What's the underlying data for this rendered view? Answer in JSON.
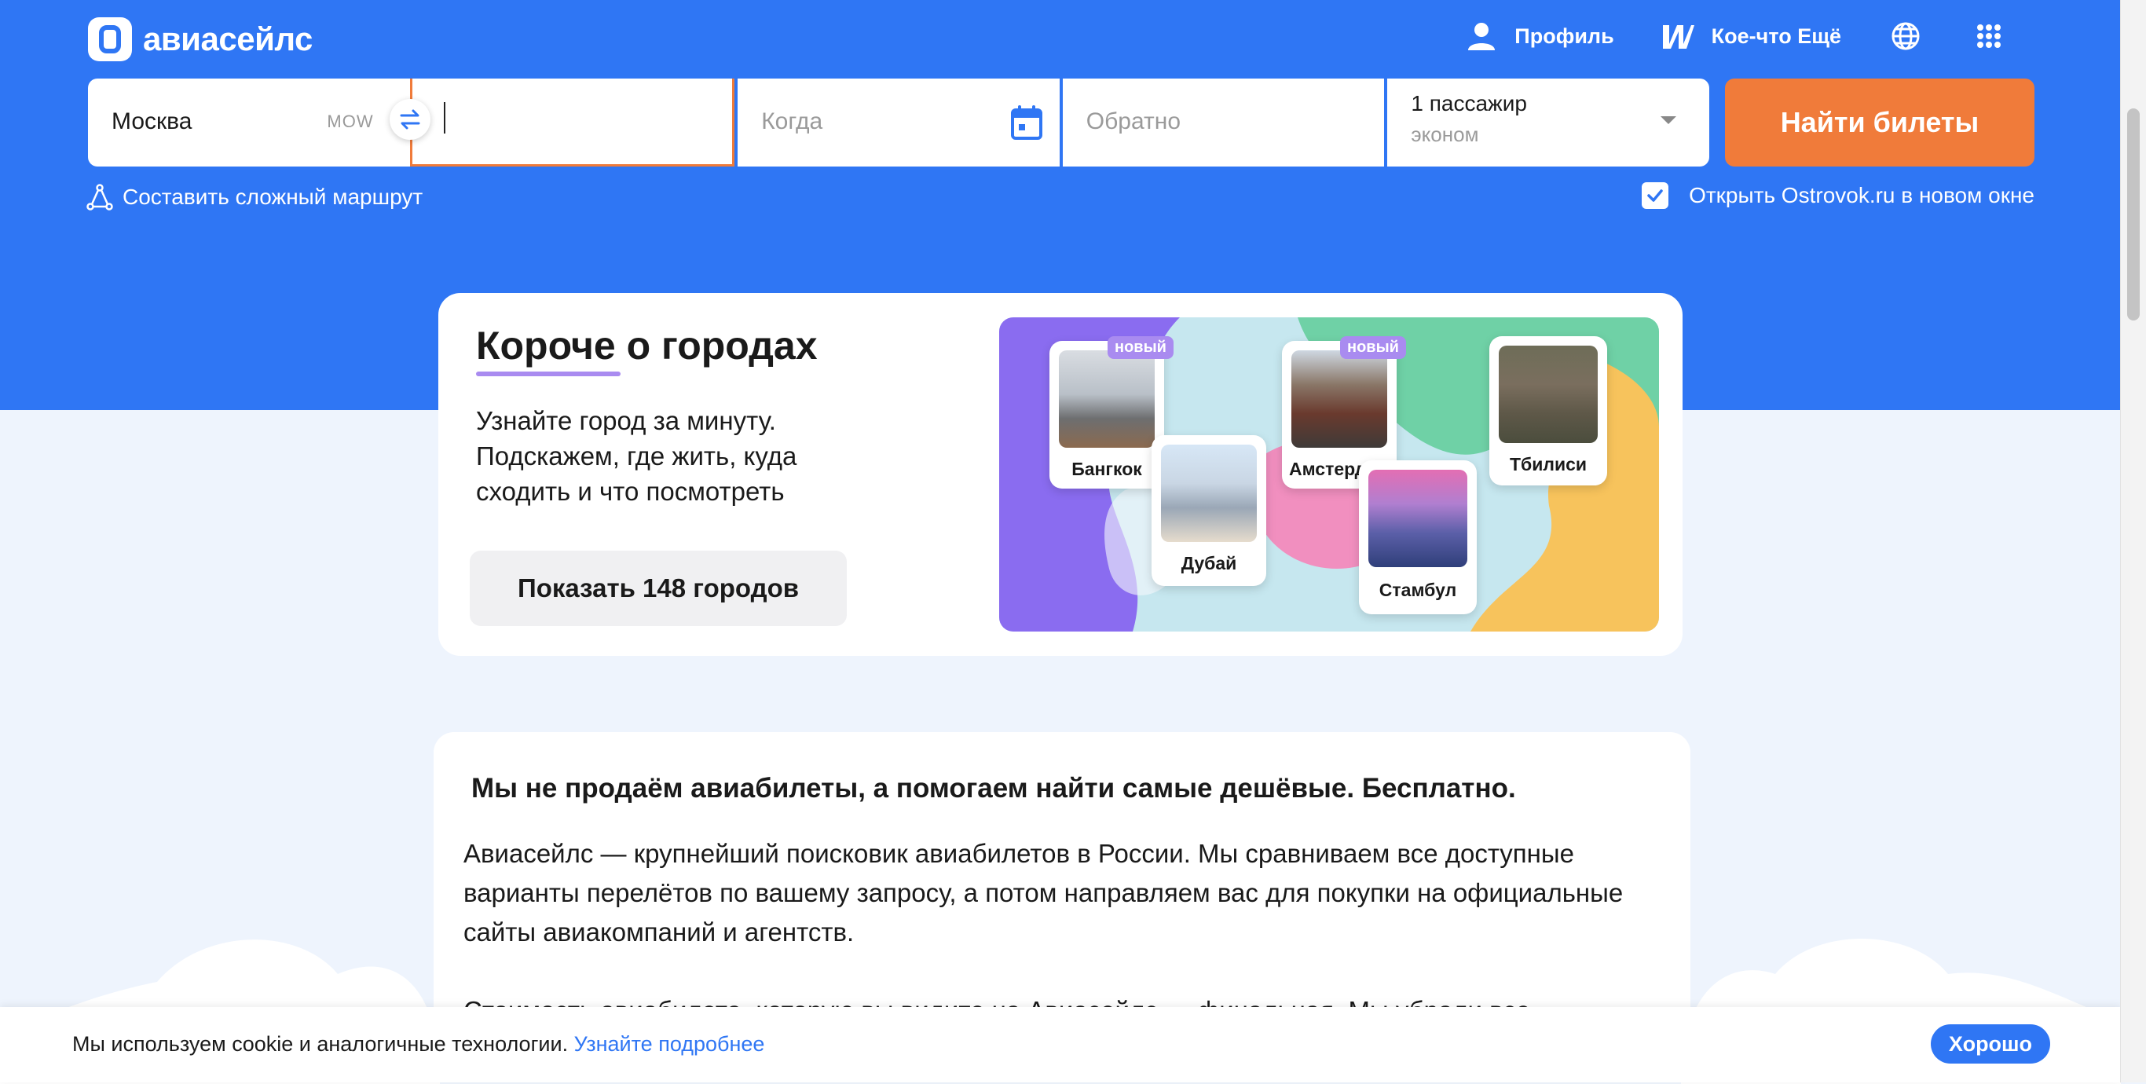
{
  "brand": {
    "logo_text": "авиасейлс",
    "colors": {
      "primary": "#2f76f4",
      "accent": "#f07b3a",
      "purple": "#a98bf0"
    }
  },
  "nav": {
    "profile": "Профиль",
    "more": "Кое-что Ещё"
  },
  "search": {
    "origin_value": "Москва",
    "origin_iata": "MOW",
    "destination_value": "",
    "date_placeholder": "Когда",
    "return_placeholder": "Обратно",
    "passengers": "1 пассажир",
    "class": "эконом",
    "submit_label": "Найти билеты"
  },
  "options": {
    "complex_route": "Составить сложный маршрут",
    "ostrovok_label": "Открыть Ostrovok.ru в новом окне",
    "ostrovok_checked": true
  },
  "cities": {
    "title": "Короче о городах",
    "description": "Узнайте город за минуту. Подскажем, где жить, куда сходить и что посмотреть",
    "button": "Показать 148 городов",
    "badge": "новый",
    "items": [
      "Бангкок",
      "Дубай",
      "Амстердам",
      "Стамбул",
      "Тбилиси"
    ]
  },
  "info": {
    "title": "Мы не продаём авиабилеты, а помогаем найти самые дешёвые. Бесплатно.",
    "paragraph": "Авиасейлс — крупнейший поисковик авиабилетов в России. Мы сравниваем все доступные варианты перелётов по вашему запросу, а потом направляем вас для покупки на официальные сайты авиакомпаний и агентств.",
    "paragraph2": "Стоимость авиабилета, которую вы видите на Авиасейлс — финальная. Мы убрали все"
  },
  "cookie": {
    "text": "Мы используем cookie и аналогичные технологии. ",
    "link": "Узнайте подробнее",
    "button": "Хорошо"
  }
}
